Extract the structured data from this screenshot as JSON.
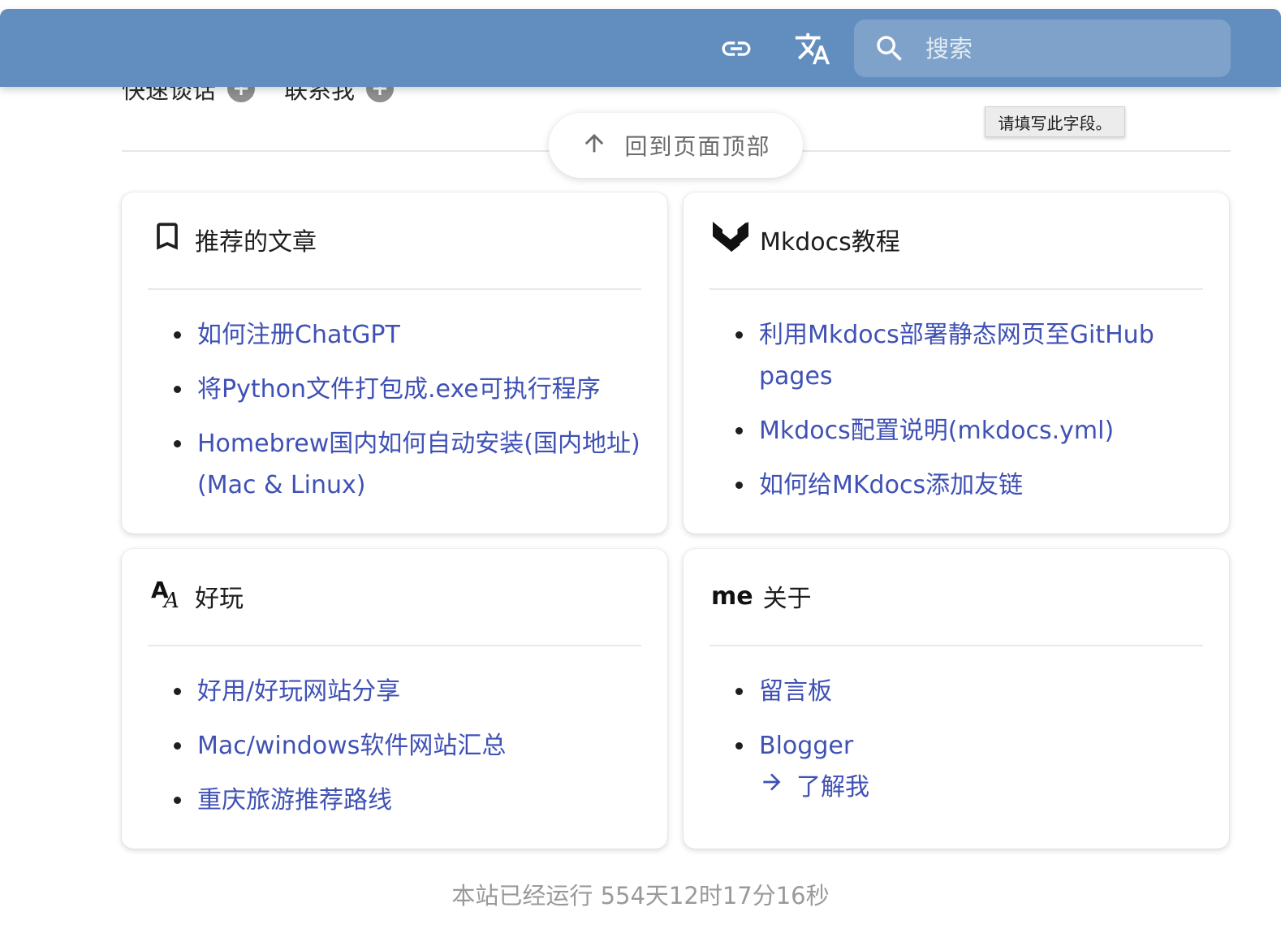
{
  "top_links": [
    {
      "label": "快速谈话"
    },
    {
      "label": "联系我"
    }
  ],
  "header": {
    "link_icon": "link-icon",
    "translate_icon": "translate-icon",
    "search_icon": "search-icon",
    "search_placeholder": "搜索",
    "color": "#628ebf"
  },
  "tooltip": "请填写此字段。",
  "back_to_top": "回到页面顶部",
  "cards": [
    {
      "title": "推荐的文章",
      "icon": "bookmark-icon",
      "items": [
        "如何注册ChatGPT",
        "将Python文件打包成.exe可执行程序",
        "Homebrew国内如何自动安装(国内地址)(Mac & Linux)"
      ]
    },
    {
      "title": "Mkdocs教程",
      "icon": "material-mkdocs-icon",
      "items": [
        "利用Mkdocs部署静态网页至GitHub pages",
        "Mkdocs配置说明(mkdocs.yml)",
        "如何给MKdocs添加友链"
      ]
    },
    {
      "title": "好玩",
      "icon": "font-icon",
      "items": [
        "好用/好玩网站分享",
        "Mac/windows软件网站汇总",
        "重庆旅游推荐路线"
      ]
    },
    {
      "title": "关于",
      "icon_text": "me",
      "items": [
        "留言板",
        "Blogger"
      ],
      "more_link": "了解我"
    }
  ],
  "footer": "本站已经运行 554天12时17分16秒",
  "link_color": "#3f51b5"
}
